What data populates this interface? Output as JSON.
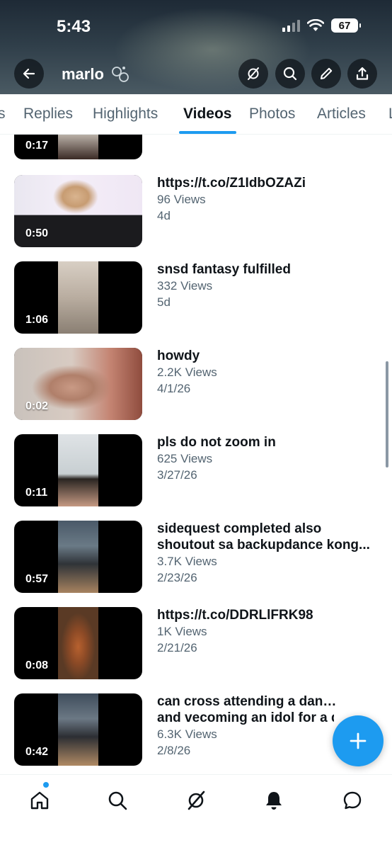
{
  "status_bar": {
    "time": "5:43",
    "battery": "67"
  },
  "header": {
    "profile_name": "marlo"
  },
  "tabs": [
    {
      "label": "s"
    },
    {
      "label": "Replies"
    },
    {
      "label": "Highlights"
    },
    {
      "label": "Videos",
      "active": true
    },
    {
      "label": "Photos"
    },
    {
      "label": "Articles"
    },
    {
      "label": "L"
    }
  ],
  "videos": [
    {
      "duration": "0:17",
      "title": "",
      "views": "",
      "date": ""
    },
    {
      "duration": "0:50",
      "title": "https://t.co/Z1IdbOZAZi",
      "views": "96 Views",
      "date": "4d"
    },
    {
      "duration": "1:06",
      "title": "snsd fantasy fulfilled",
      "views": "332 Views",
      "date": "5d"
    },
    {
      "duration": "0:02",
      "title": "howdy",
      "views": "2.2K Views",
      "date": "4/1/26"
    },
    {
      "duration": "0:11",
      "title": "pls do not zoom in",
      "views": "625 Views",
      "date": "3/27/26"
    },
    {
      "duration": "0:57",
      "title": "sidequest completed also",
      "title_line2": "shoutout sa backupdance kong...",
      "views": "3.7K Views",
      "date": "2/23/26"
    },
    {
      "duration": "0:08",
      "title": "https://t.co/DDRLlFRK98",
      "views": "1K Views",
      "date": "2/21/26"
    },
    {
      "duration": "0:42",
      "title": "can cross attending a dance class",
      "title_line2": "and vecoming an idol for a da",
      "views": "6.3K Views",
      "date": "2/8/26"
    }
  ],
  "colors": {
    "accent": "#1d9bf0",
    "text_primary": "#0f1419",
    "text_secondary": "#536471"
  },
  "icons": {
    "back": "arrow-left-icon",
    "grok": "grok-icon",
    "search": "search-icon",
    "edit": "pencil-icon",
    "share": "share-icon",
    "compose": "plus-icon",
    "home": "home-icon",
    "explore": "search-icon",
    "grok_nav": "grok-icon",
    "notifications": "bell-icon",
    "messages": "message-icon"
  }
}
